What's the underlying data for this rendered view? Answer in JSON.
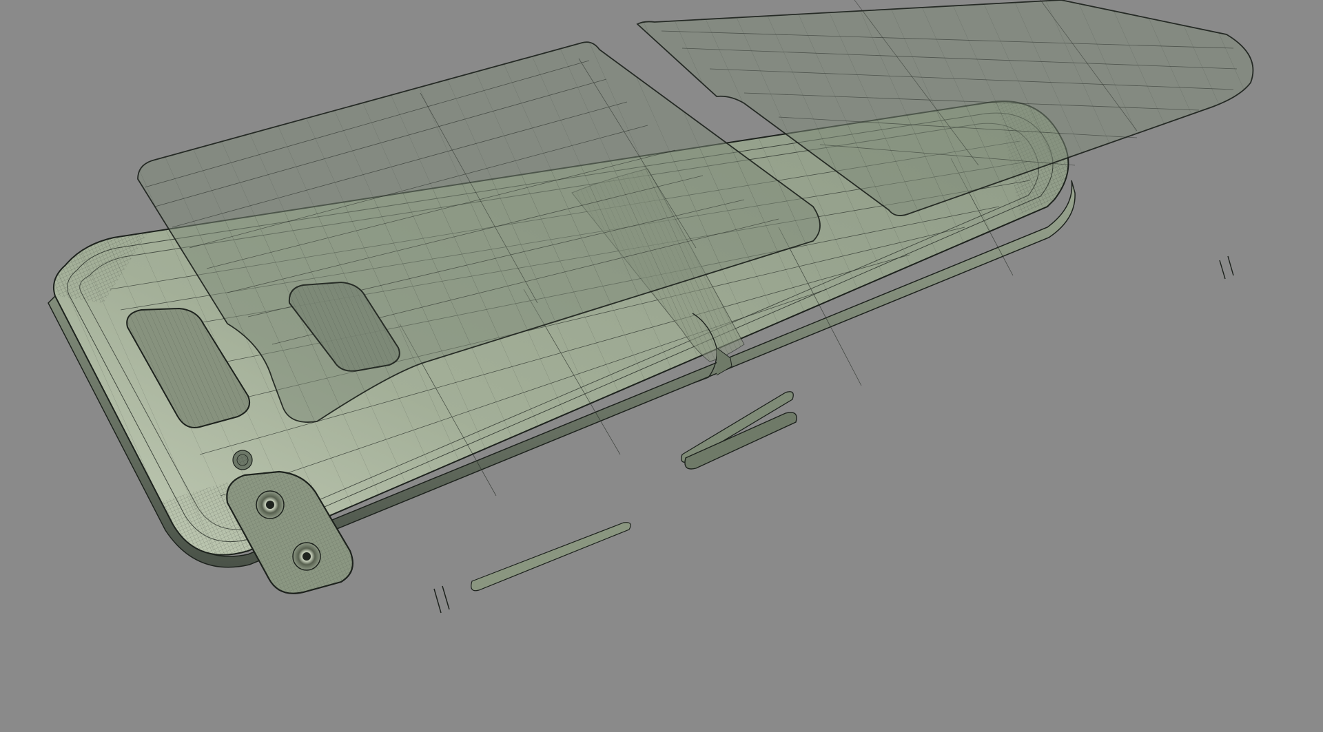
{
  "scene": {
    "subject": "foldable-phone-wireframe-render",
    "background_color": "#8a8a8a",
    "body_color": "#97a38e",
    "body_highlight_color": "#b9c4ac",
    "glass_panel_color": "#7d8a78",
    "wire_color": "#232823",
    "camera_lenses": 2,
    "parts": [
      "main-body",
      "cover-glass-panel-left",
      "cover-glass-panel-right",
      "camera-module",
      "hinge"
    ]
  }
}
